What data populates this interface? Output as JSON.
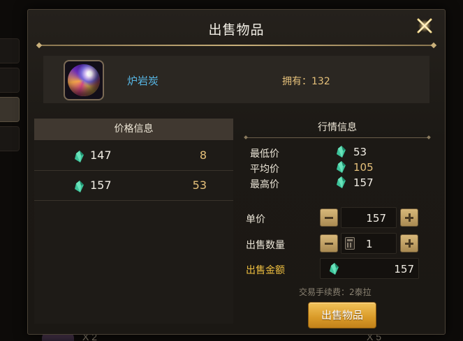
{
  "dialog": {
    "title": "出售物品",
    "item_name": "炉岩炭",
    "owned_label": "拥有：",
    "owned_count": "132"
  },
  "price_info": {
    "header": "价格信息",
    "rows": [
      {
        "price": "147",
        "qty": "8"
      },
      {
        "price": "157",
        "qty": "53"
      }
    ]
  },
  "market_info": {
    "header": "行情信息",
    "rows": [
      {
        "label": "最低价",
        "value": "53"
      },
      {
        "label": "平均价",
        "value": "105"
      },
      {
        "label": "最高价",
        "value": "157"
      }
    ]
  },
  "form": {
    "unit_price_label": "单价",
    "unit_price": "157",
    "quantity_label": "出售数量",
    "quantity": "1",
    "total_label": "出售金额",
    "total": "157",
    "fee_text": "交易手续费：2泰拉",
    "sell_button": "出售物品"
  },
  "background": {
    "count_left": "X 2",
    "count_right": "X 5"
  },
  "colors": {
    "accent_gold": "#e5c07a",
    "item_name_blue": "#57b6e4",
    "sell_button": "#d99a28"
  },
  "icons": [
    "gem-icon",
    "close-icon",
    "calculator-icon",
    "minus-icon",
    "plus-icon"
  ]
}
